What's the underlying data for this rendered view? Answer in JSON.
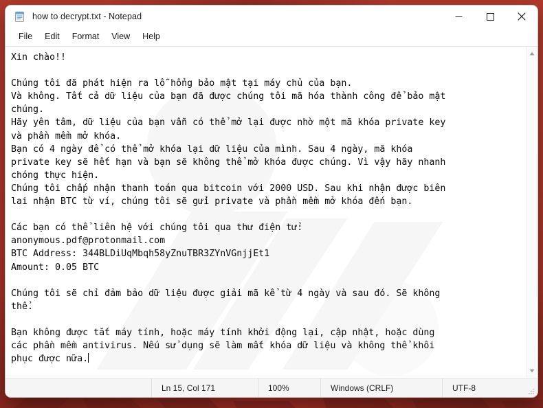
{
  "window": {
    "title": "how to decrypt.txt - Notepad",
    "icon": "notepad-icon",
    "controls": {
      "minimize": "minimize-icon",
      "maximize": "maximize-icon",
      "close": "close-icon"
    },
    "border_color": "#b03a2e"
  },
  "menu": {
    "items": [
      {
        "label": "File"
      },
      {
        "label": "Edit"
      },
      {
        "label": "Format"
      },
      {
        "label": "View"
      },
      {
        "label": "Help"
      }
    ]
  },
  "editor": {
    "text": "Xin chào!!\n\nChúng tôi đã phát hiện ra lỗ hổng bảo mật tại máy chủ của bạn.\nVà không. Tất cả dữ liệu của bạn đã được chúng tôi mã hóa thành công để bảo mật\nchúng.\nHãy yên tâm, dữ liệu của bạn vẫn có thể mở lại được nhờ một mã khóa private key\nvà phần mềm mở khóa.\nBạn có 4 ngày để có thể mở khóa lại dữ liệu của mình. Sau 4 ngày, mã khóa\nprivate key sẽ hết hạn và bạn sẽ không thể mở khóa được chúng. Vì vậy hãy nhanh\nchóng thực hiện.\nChúng tôi chấp nhận thanh toán qua bitcoin với 2000 USD. Sau khi nhận được biên\nlai nhận BTC từ ví, chúng tôi sẽ gửi private và phần mềm mở khóa đến bạn.\n\nCác bạn có thể liên hệ với chúng tôi qua thư điện tử:\nanonymous.pdf@protonmail.com\nBTC Address: 344BLDiUqMbqh58yZnuTBR3ZYnVGnjjEt1\nAmount: 0.05 BTC\n\nChúng tôi sẽ chỉ đảm bảo dữ liệu được giải mã kể từ 4 ngày và sau đó. Sẽ không\nthể.\n\nBạn không được tắt máy tính, hoặc máy tính khởi động lại, cập nhật, hoặc dùng\ncác phần mềm antivirus. Nếu sử dụng sẽ làm mất khóa dữ liệu và không thể khôi\nphục được nữa.",
    "contact_email": "anonymous.pdf@protonmail.com",
    "btc_address": "344BLDiUqMbqh58yZnuTBR3ZYnVGnjjEt1",
    "amount": "0.05 BTC",
    "ransom_usd": "2000 USD",
    "deadline_days": "4"
  },
  "scrollbar": {
    "up_arrow": "scroll-up-icon",
    "down_arrow": "scroll-down-icon"
  },
  "status_bar": {
    "line_col": "Ln 15, Col 171",
    "zoom": "100%",
    "line_ending": "Windows (CRLF)",
    "encoding": "UTF-8"
  }
}
